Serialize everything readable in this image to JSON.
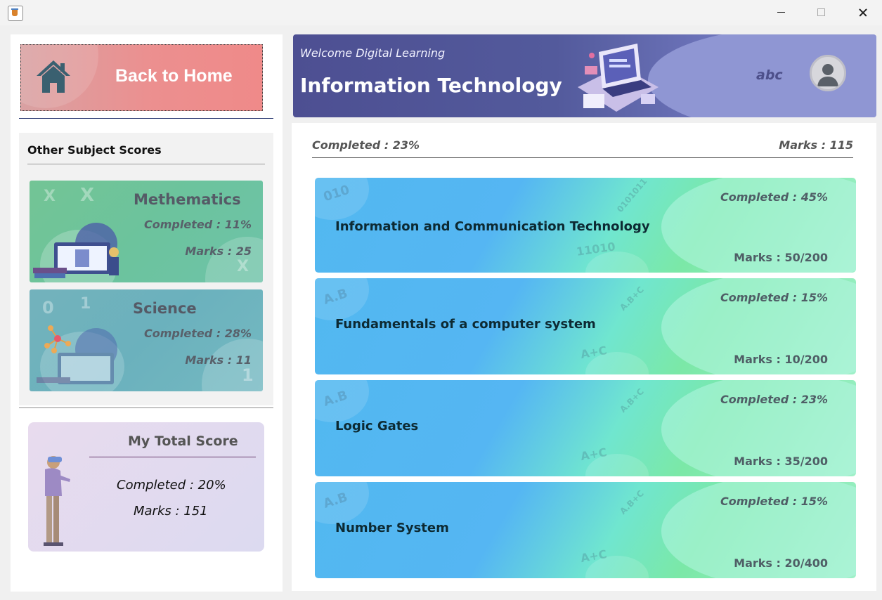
{
  "window": {
    "app_icon": "java-cup-icon",
    "controls": [
      "minimize-icon",
      "maximize-icon",
      "close-icon"
    ]
  },
  "sidebar": {
    "home_button": {
      "label": "Back to Home",
      "icon": "home-icon"
    },
    "other_scores_title": "Other Subject Scores",
    "subjects": [
      {
        "name": "Methematics",
        "completed": "Completed : 11%",
        "marks": "Marks : 25"
      },
      {
        "name": "Science",
        "completed": "Completed : 28%",
        "marks": "Marks : 11"
      }
    ],
    "total": {
      "title": "My Total Score",
      "completed": "Completed : 20%",
      "marks": "Marks : 151"
    }
  },
  "header": {
    "welcome": "Welcome Digital Learning",
    "title": "Information Technology",
    "username": "abc",
    "avatar_icon": "user-avatar-icon"
  },
  "summary": {
    "completed": "Completed : 23%",
    "marks": "Marks : 115"
  },
  "lessons": [
    {
      "title": "Information and Communication Technology",
      "completed": "Completed : 45%",
      "marks": "Marks : 50/200"
    },
    {
      "title": "Fundamentals of a computer  system",
      "completed": "Completed : 15%",
      "marks": "Marks : 10/200"
    },
    {
      "title": "Logic Gates",
      "completed": "Completed : 23%",
      "marks": "Marks : 35/200"
    },
    {
      "title": "Number System",
      "completed": "Completed : 15%",
      "marks": "Marks : 20/400"
    }
  ],
  "decorations": {
    "binary_a": "010",
    "binary_b": "0101011",
    "binary_c": "11010",
    "ab": "A.B",
    "abc": "A.B+C",
    "apc": "A+C",
    "zero": "0",
    "one": "1",
    "x": "X"
  }
}
